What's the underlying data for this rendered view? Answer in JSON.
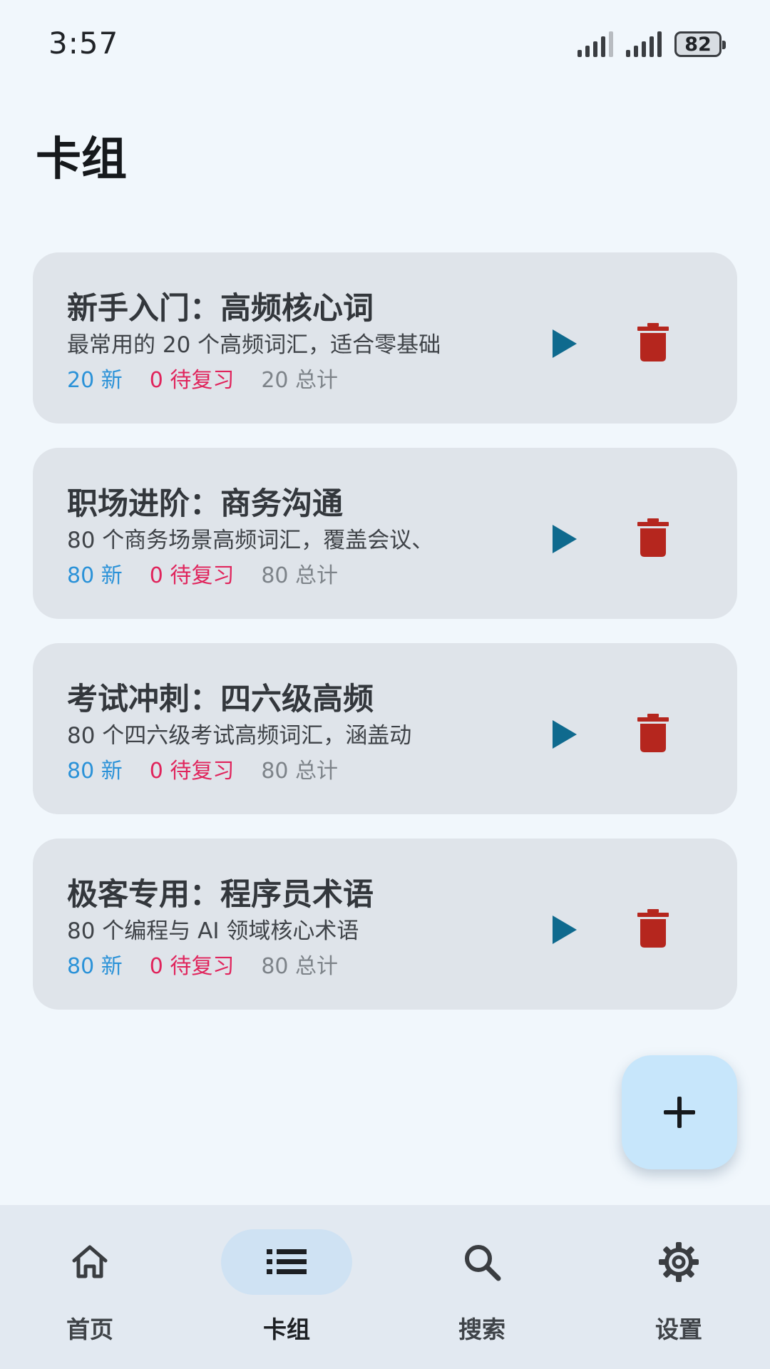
{
  "status_bar": {
    "time": "3:57",
    "battery": "82"
  },
  "page": {
    "title": "卡组"
  },
  "colors": {
    "new": "#2b92d8",
    "due": "#e0245c",
    "total": "#7d8389",
    "play": "#0f6a8e",
    "delete": "#b5261e",
    "fab": "#c7e6fb"
  },
  "decks": [
    {
      "title": "新手入门：高频核心词",
      "description": "最常用的 20 个高频词汇，适合零基础",
      "new": "20 新",
      "due": "0 待复习",
      "total": "20 总计"
    },
    {
      "title": "职场进阶：商务沟通",
      "description": "80 个商务场景高频词汇，覆盖会议、",
      "new": "80 新",
      "due": "0 待复习",
      "total": "80 总计"
    },
    {
      "title": "考试冲刺：四六级高频",
      "description": "80 个四六级考试高频词汇，涵盖动",
      "new": "80 新",
      "due": "0 待复习",
      "total": "80 总计"
    },
    {
      "title": "极客专用：程序员术语",
      "description": "80 个编程与 AI 领域核心术语",
      "new": "80 新",
      "due": "0 待复习",
      "total": "80 总计"
    }
  ],
  "nav": {
    "items": [
      {
        "label": "首页",
        "icon": "home-icon"
      },
      {
        "label": "卡组",
        "icon": "list-icon"
      },
      {
        "label": "搜索",
        "icon": "search-icon"
      },
      {
        "label": "设置",
        "icon": "gear-icon"
      }
    ],
    "active": "卡组"
  }
}
